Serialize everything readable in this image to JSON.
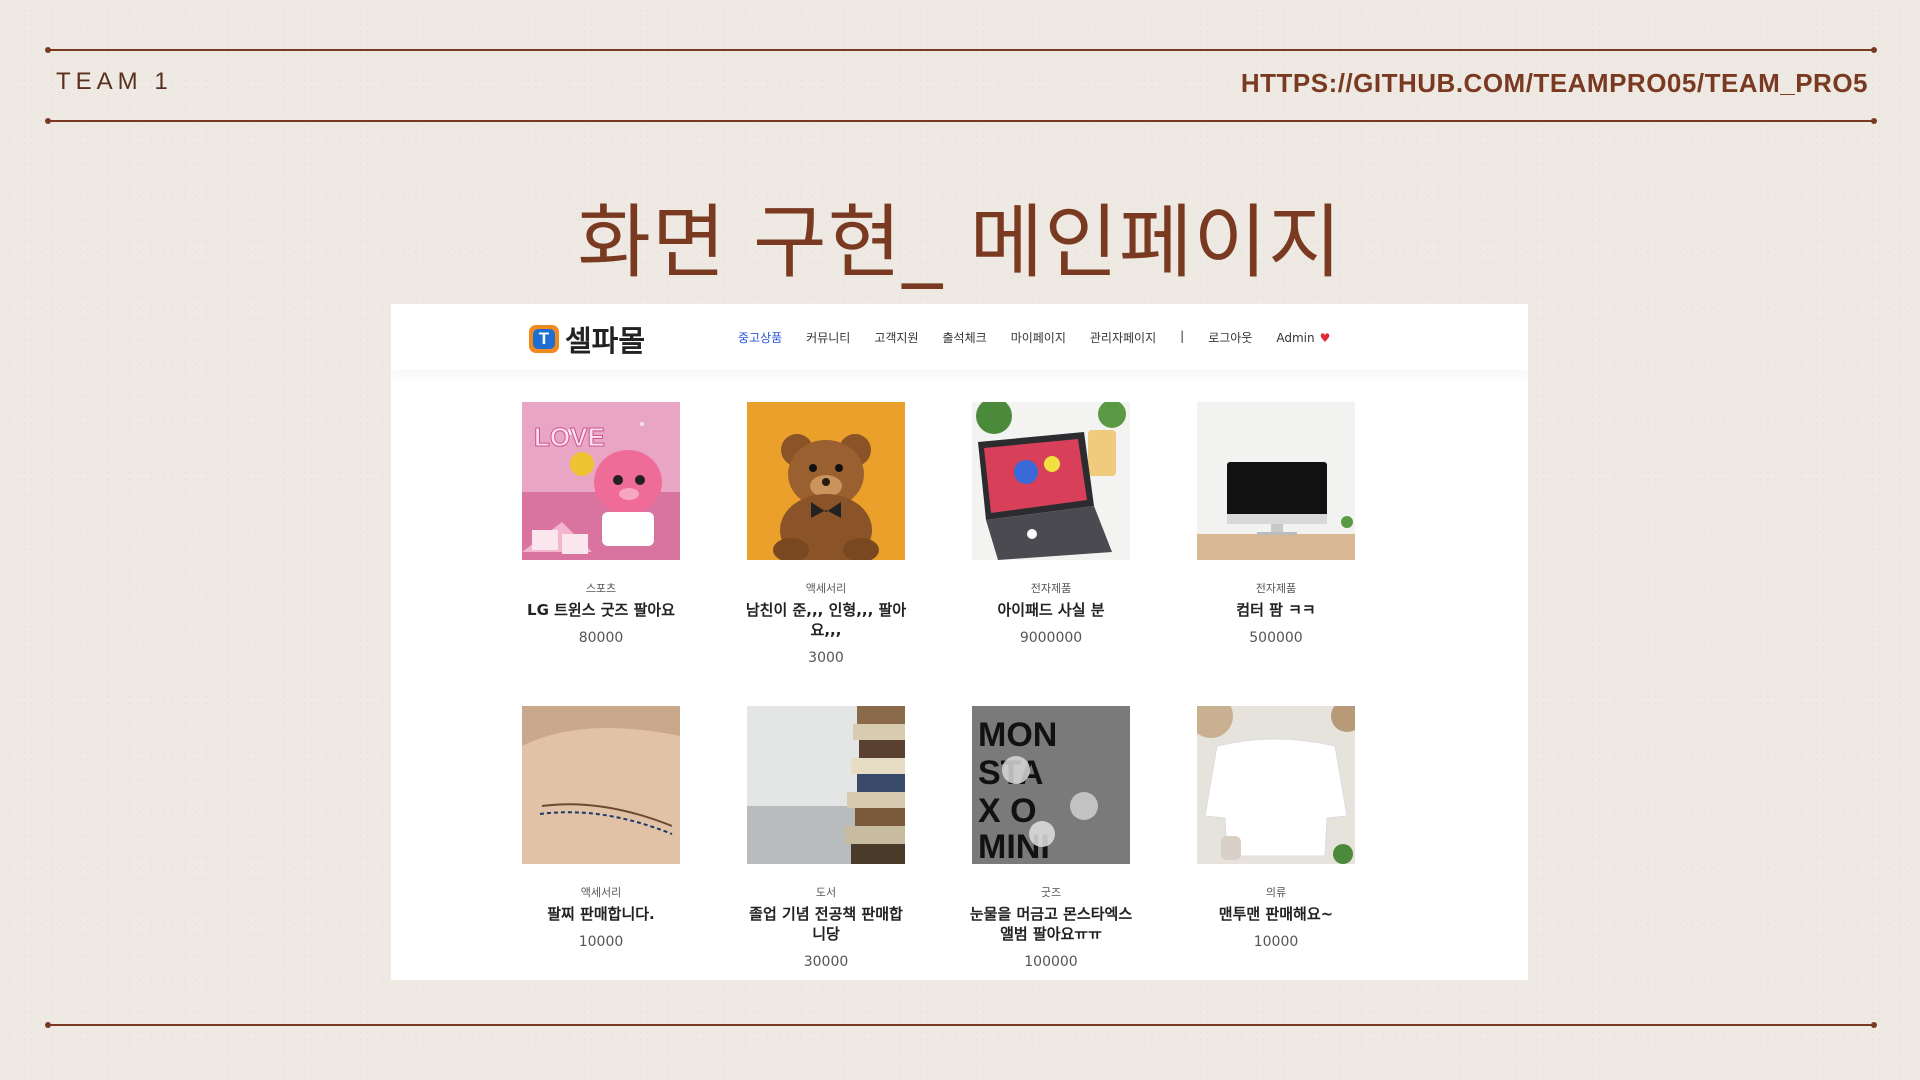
{
  "slide": {
    "team": "TEAM 1",
    "url": "HTTPS://GITHUB.COM/TEAMPRO05/TEAM_PRO5",
    "title": "화면 구현_ 메인페이지"
  },
  "site": {
    "logo_icon": "T",
    "logo_text": "셀파몰",
    "nav": [
      "중고상품",
      "커뮤니티",
      "고객지원",
      "출석체크",
      "마이페이지",
      "관리자페이지",
      "|",
      "로그아웃"
    ],
    "admin": "Admin",
    "accent": "#2a56d8"
  },
  "products": [
    {
      "category": "스포츠",
      "name": "LG 트윈스 굿즈 팔아요",
      "price": "80000",
      "image": "pink-plush-goods"
    },
    {
      "category": "액세서리",
      "name": "남친이 준,,, 인형,,, 팔아요,,,",
      "price": "3000",
      "image": "teddy-bear"
    },
    {
      "category": "전자제품",
      "name": "아이패드 사실 분",
      "price": "9000000",
      "image": "ipad-keyboard"
    },
    {
      "category": "전자제품",
      "name": "컴터 팜 ㅋㅋ",
      "price": "500000",
      "image": "desktop-computer"
    },
    {
      "category": "액세서리",
      "name": "팔찌 판매합니다.",
      "price": "10000",
      "image": "bracelet"
    },
    {
      "category": "도서",
      "name": "졸업 기념 전공책 판매합니당",
      "price": "30000",
      "image": "book-stack"
    },
    {
      "category": "굿즈",
      "name": "눈물을 머금고 몬스타엑스 앨범 팔아요ㅠㅠ",
      "price": "100000",
      "image": "album-cover"
    },
    {
      "category": "의류",
      "name": "맨투맨 판매해요~",
      "price": "10000",
      "image": "white-sweatshirt"
    }
  ]
}
